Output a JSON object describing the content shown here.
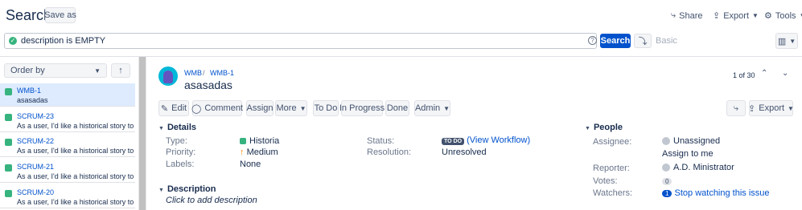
{
  "header": {
    "title": "Search",
    "save_as": "Save as",
    "share": "Share",
    "export": "Export",
    "tools": "Tools"
  },
  "query": {
    "text": "description is EMPTY",
    "search_label": "Search",
    "basic_label": "Basic"
  },
  "list": {
    "order_by": "Order by",
    "items": [
      {
        "key": "WMB-1",
        "summary": "asasadas"
      },
      {
        "key": "SCRUM-23",
        "summary": "As a user, I'd like a historical story to"
      },
      {
        "key": "SCRUM-22",
        "summary": "As a user, I'd like a historical story to"
      },
      {
        "key": "SCRUM-21",
        "summary": "As a user, I'd like a historical story to"
      },
      {
        "key": "SCRUM-20",
        "summary": "As a user, I'd like a historical story to"
      }
    ]
  },
  "issue": {
    "project": "WMB",
    "separator": "/",
    "key": "WMB-1",
    "summary": "asasadas",
    "pager": "1 of 30"
  },
  "toolbar": {
    "edit": "Edit",
    "comment": "Comment",
    "assign": "Assign",
    "more": "More",
    "to_do": "To Do",
    "in_progress": "In Progress",
    "done": "Done",
    "admin": "Admin",
    "export": "Export"
  },
  "details": {
    "heading": "Details",
    "type_label": "Type:",
    "type_value": "Historia",
    "priority_label": "Priority:",
    "priority_value": "Medium",
    "labels_label": "Labels:",
    "labels_value": "None",
    "status_label": "Status:",
    "status_value": "TO DO",
    "view_workflow": "(View Workflow)",
    "resolution_label": "Resolution:",
    "resolution_value": "Unresolved"
  },
  "description": {
    "heading": "Description",
    "placeholder": "Click to add description"
  },
  "people": {
    "heading": "People",
    "assignee_label": "Assignee:",
    "assignee_value": "Unassigned",
    "assign_to_me": "Assign to me",
    "reporter_label": "Reporter:",
    "reporter_value": "A.D. Ministrator",
    "votes_label": "Votes:",
    "votes_value": "0",
    "watchers_label": "Watchers:",
    "watchers_value": "1",
    "stop_watching": "Stop watching this issue"
  }
}
